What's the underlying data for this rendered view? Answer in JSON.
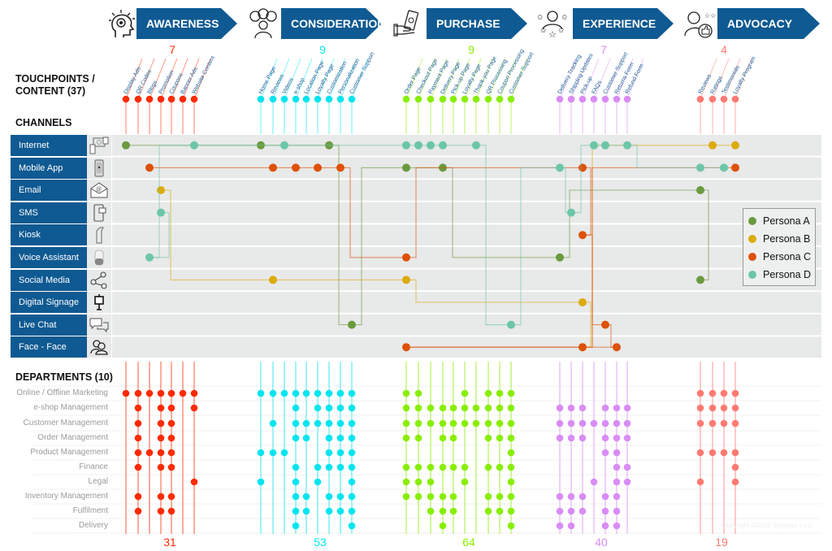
{
  "stages": [
    {
      "name": "AWARENESS",
      "icon": "head-idea-icon",
      "color": "#ff2a00",
      "touchpoint_count": "7",
      "department_total": "31",
      "touchpoints": [
        "Display Ads",
        "QR Codes",
        "Blogs",
        "Promotion",
        "Coupons",
        "Banner Ads",
        "Website Content"
      ]
    },
    {
      "name": "CONSIDERATION",
      "icon": "people-thinking-icon",
      "color": "#00e5f0",
      "touchpoint_count": "9",
      "department_total": "53",
      "touchpoints": [
        "Home Page",
        "Reviews",
        "Videos",
        "e-shop",
        "Location Page",
        "Loyalty Page",
        "Customization",
        "Personalization",
        "Customer Support"
      ]
    },
    {
      "name": "PURCHASE",
      "icon": "hand-money-icon",
      "color": "#88ee00",
      "touchpoint_count": "9",
      "department_total": "64",
      "touchpoints": [
        "Order Page",
        "Checkout Page",
        "Payment Page",
        "Delivery Page",
        "Pick-up Page",
        "Loyalty Page",
        "Thank-you Page",
        "QR Processing",
        "Coupon Processing",
        "Customer Support"
      ]
    },
    {
      "name": "EXPERIENCE",
      "icon": "user-stars-icon",
      "color": "#d98cf5",
      "touchpoint_count": "7",
      "department_total": "40",
      "touchpoints": [
        "Delivery Tracking",
        "Shipping Updates",
        "Pick-up",
        "FAQs",
        "Customer Support",
        "Returns Form",
        "Refund Form"
      ]
    },
    {
      "name": "ADVOCACY",
      "icon": "user-thumbs-up-icon",
      "color": "#ff7a72",
      "touchpoint_count": "4",
      "department_total": "19",
      "touchpoints": [
        "Reviews",
        "Ratings",
        "Testimonials",
        "Loyalty Program"
      ]
    }
  ],
  "labels": {
    "touchpoints_title": "TOUCHPOINTS /",
    "touchpoints_title2": "CONTENT (37)",
    "channels_title": "CHANNELS",
    "departments_title": "DEPARTMENTS (10)",
    "copyright": "Copyright ©2019 Synegys s.r.o."
  },
  "channels": [
    {
      "label": "Internet",
      "icon": "devices-icon"
    },
    {
      "label": "Mobile App",
      "icon": "mobile-phone-icon"
    },
    {
      "label": "Email",
      "icon": "email-envelope-icon"
    },
    {
      "label": "SMS",
      "icon": "sms-phone-icon"
    },
    {
      "label": "Kiosk",
      "icon": "kiosk-icon"
    },
    {
      "label": "Voice Assistant",
      "icon": "smart-speaker-icon"
    },
    {
      "label": "Social Media",
      "icon": "share-icon"
    },
    {
      "label": "Digital Signage",
      "icon": "signage-icon"
    },
    {
      "label": "Live Chat",
      "icon": "chat-bubbles-icon"
    },
    {
      "label": "Face - Face",
      "icon": "people-icon"
    }
  ],
  "departments": [
    "Online / Offline Marketing",
    "e-shop Management",
    "Customer Management",
    "Order Management",
    "Product Management",
    "Finance",
    "Legal",
    "Inventory Management",
    "Fulfilment",
    "Delivery"
  ],
  "legend": [
    {
      "name": "Persona A",
      "color": "#6a9a3e"
    },
    {
      "name": "Persona B",
      "color": "#dcab0c"
    },
    {
      "name": "Persona C",
      "color": "#dd5108"
    },
    {
      "name": "Persona D",
      "color": "#6cc6a8"
    }
  ],
  "department_matrix": [
    [
      [
        1,
        1,
        1,
        1,
        1,
        1,
        1
      ],
      [
        0,
        1,
        0,
        1,
        1,
        0,
        1
      ],
      [
        0,
        1,
        0,
        1,
        1,
        0,
        0
      ],
      [
        0,
        1,
        0,
        1,
        1,
        0,
        0
      ],
      [
        0,
        1,
        1,
        1,
        1,
        0,
        0
      ],
      [
        0,
        1,
        0,
        1,
        1,
        0,
        0
      ],
      [
        0,
        0,
        0,
        0,
        0,
        0,
        1
      ],
      [
        0,
        1,
        0,
        1,
        1,
        0,
        0
      ],
      [
        0,
        1,
        0,
        1,
        1,
        0,
        0
      ],
      [
        0,
        0,
        0,
        0,
        0,
        0,
        0
      ]
    ],
    [
      [
        1,
        1,
        1,
        1,
        1,
        1,
        1,
        1,
        1
      ],
      [
        0,
        0,
        0,
        1,
        0,
        1,
        1,
        1,
        1
      ],
      [
        0,
        1,
        0,
        1,
        1,
        1,
        1,
        1,
        1
      ],
      [
        0,
        0,
        0,
        1,
        1,
        0,
        1,
        1,
        1
      ],
      [
        1,
        1,
        1,
        0,
        0,
        0,
        1,
        1,
        1
      ],
      [
        0,
        0,
        0,
        1,
        0,
        1,
        1,
        1,
        1
      ],
      [
        1,
        0,
        0,
        1,
        0,
        1,
        0,
        0,
        1
      ],
      [
        0,
        0,
        0,
        1,
        1,
        0,
        1,
        1,
        1
      ],
      [
        0,
        0,
        0,
        1,
        1,
        0,
        1,
        1,
        1
      ],
      [
        0,
        0,
        0,
        1,
        0,
        0,
        0,
        0,
        1
      ]
    ],
    [
      [
        1,
        1,
        0,
        0,
        0,
        1,
        0,
        1,
        1,
        1
      ],
      [
        1,
        1,
        1,
        1,
        1,
        1,
        1,
        1,
        1,
        1
      ],
      [
        1,
        1,
        1,
        1,
        1,
        1,
        1,
        1,
        1,
        1
      ],
      [
        1,
        1,
        0,
        1,
        1,
        0,
        0,
        1,
        1,
        1
      ],
      [
        0,
        0,
        0,
        0,
        0,
        0,
        0,
        0,
        0,
        1
      ],
      [
        1,
        1,
        1,
        1,
        1,
        1,
        0,
        1,
        1,
        1
      ],
      [
        1,
        1,
        1,
        0,
        0,
        1,
        0,
        0,
        0,
        1
      ],
      [
        1,
        1,
        1,
        1,
        1,
        0,
        0,
        1,
        1,
        1
      ],
      [
        0,
        0,
        1,
        1,
        1,
        0,
        0,
        1,
        1,
        1
      ],
      [
        0,
        0,
        0,
        1,
        0,
        0,
        0,
        0,
        0,
        1
      ]
    ],
    [
      [
        0,
        0,
        0,
        0,
        0,
        0,
        0
      ],
      [
        1,
        1,
        1,
        0,
        1,
        1,
        1
      ],
      [
        1,
        1,
        1,
        1,
        1,
        1,
        1
      ],
      [
        1,
        1,
        1,
        0,
        1,
        1,
        1
      ],
      [
        0,
        0,
        0,
        0,
        1,
        1,
        0
      ],
      [
        0,
        0,
        0,
        0,
        0,
        1,
        1
      ],
      [
        0,
        0,
        0,
        1,
        0,
        1,
        1
      ],
      [
        1,
        1,
        1,
        0,
        1,
        1,
        0
      ],
      [
        1,
        1,
        1,
        0,
        1,
        1,
        0
      ],
      [
        1,
        1,
        0,
        0,
        1,
        1,
        0
      ]
    ],
    [
      [
        1,
        1,
        1,
        1
      ],
      [
        1,
        1,
        1,
        1
      ],
      [
        1,
        1,
        1,
        1
      ],
      [
        0,
        0,
        0,
        0
      ],
      [
        1,
        1,
        1,
        1
      ],
      [
        0,
        0,
        0,
        1
      ],
      [
        1,
        0,
        0,
        1
      ],
      [
        0,
        0,
        0,
        0
      ],
      [
        0,
        0,
        0,
        0
      ],
      [
        0,
        0,
        0,
        0
      ]
    ]
  ],
  "persona_journeys": {
    "Persona A": [
      {
        "stage": 0,
        "touchpoint": 0,
        "channel": "Internet"
      },
      {
        "stage": 1,
        "touchpoint": 0,
        "channel": "Internet"
      },
      {
        "stage": 1,
        "touchpoint": 6,
        "channel": "Internet"
      },
      {
        "stage": 1,
        "touchpoint": 8,
        "channel": "Live Chat"
      },
      {
        "stage": 2,
        "touchpoint": 0,
        "channel": "Mobile App"
      },
      {
        "stage": 2,
        "touchpoint": 3,
        "channel": "Mobile App"
      },
      {
        "stage": 3,
        "touchpoint": 0,
        "channel": "Voice Assistant"
      },
      {
        "stage": 4,
        "touchpoint": 0,
        "channel": "Email"
      },
      {
        "stage": 4,
        "touchpoint": 0,
        "channel": "Social Media"
      }
    ],
    "Persona B": [
      {
        "stage": 0,
        "touchpoint": 3,
        "channel": "Email"
      },
      {
        "stage": 1,
        "touchpoint": 1,
        "channel": "Social Media"
      },
      {
        "stage": 2,
        "touchpoint": 0,
        "channel": "Social Media"
      },
      {
        "stage": 3,
        "touchpoint": 2,
        "channel": "Digital Signage"
      },
      {
        "stage": 3,
        "touchpoint": 2,
        "channel": "Face - Face"
      },
      {
        "stage": 4,
        "touchpoint": 1,
        "channel": "Internet"
      },
      {
        "stage": 4,
        "touchpoint": 3,
        "channel": "Internet"
      }
    ],
    "Persona C": [
      {
        "stage": 0,
        "touchpoint": 2,
        "channel": "Mobile App"
      },
      {
        "stage": 1,
        "touchpoint": 1,
        "channel": "Mobile App"
      },
      {
        "stage": 1,
        "touchpoint": 3,
        "channel": "Mobile App"
      },
      {
        "stage": 1,
        "touchpoint": 5,
        "channel": "Mobile App"
      },
      {
        "stage": 1,
        "touchpoint": 7,
        "channel": "Mobile App"
      },
      {
        "stage": 2,
        "touchpoint": 0,
        "channel": "Voice Assistant"
      },
      {
        "stage": 3,
        "touchpoint": 2,
        "channel": "Mobile App"
      },
      {
        "stage": 3,
        "touchpoint": 2,
        "channel": "Kiosk"
      },
      {
        "stage": 3,
        "touchpoint": 4,
        "channel": "Live Chat"
      },
      {
        "stage": 3,
        "touchpoint": 5,
        "channel": "Face - Face"
      },
      {
        "stage": 2,
        "touchpoint": 0,
        "channel": "Face - Face"
      },
      {
        "stage": 3,
        "touchpoint": 2,
        "channel": "Face - Face"
      },
      {
        "stage": 4,
        "touchpoint": 3,
        "channel": "Mobile App"
      }
    ],
    "Persona D": [
      {
        "stage": 0,
        "touchpoint": 3,
        "channel": "SMS"
      },
      {
        "stage": 0,
        "touchpoint": 2,
        "channel": "Voice Assistant"
      },
      {
        "stage": 0,
        "touchpoint": 6,
        "channel": "Internet"
      },
      {
        "stage": 1,
        "touchpoint": 2,
        "channel": "Internet"
      },
      {
        "stage": 2,
        "touchpoint": 0,
        "channel": "Internet"
      },
      {
        "stage": 2,
        "touchpoint": 1,
        "channel": "Internet"
      },
      {
        "stage": 2,
        "touchpoint": 2,
        "channel": "Internet"
      },
      {
        "stage": 2,
        "touchpoint": 3,
        "channel": "Internet"
      },
      {
        "stage": 2,
        "touchpoint": 6,
        "channel": "Internet"
      },
      {
        "stage": 2,
        "touchpoint": 9,
        "channel": "Live Chat"
      },
      {
        "stage": 3,
        "touchpoint": 0,
        "channel": "Mobile App"
      },
      {
        "stage": 3,
        "touchpoint": 1,
        "channel": "SMS"
      },
      {
        "stage": 3,
        "touchpoint": 3,
        "channel": "Internet"
      },
      {
        "stage": 3,
        "touchpoint": 4,
        "channel": "Internet"
      },
      {
        "stage": 3,
        "touchpoint": 6,
        "channel": "Internet"
      },
      {
        "stage": 4,
        "touchpoint": 0,
        "channel": "Mobile App"
      },
      {
        "stage": 4,
        "touchpoint": 2,
        "channel": "Mobile App"
      }
    ]
  }
}
